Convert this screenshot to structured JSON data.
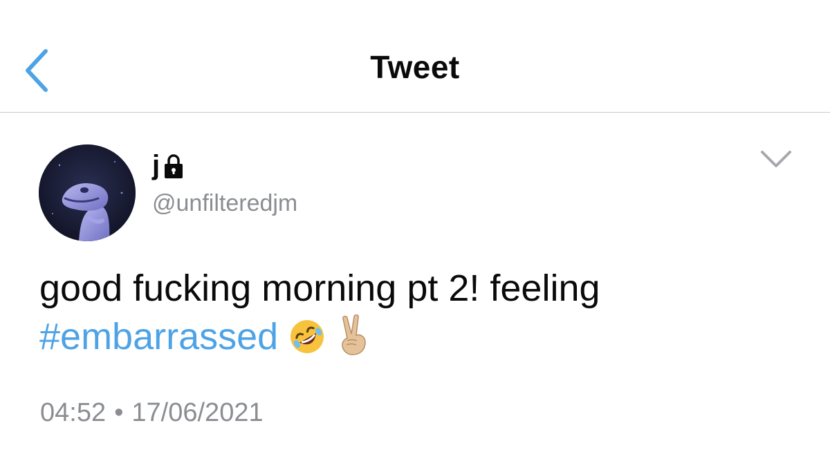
{
  "header": {
    "back_icon": "chevron-left-icon",
    "title": "Tweet"
  },
  "tweet": {
    "avatar": "user-avatar",
    "display_name": "j",
    "protected_icon": "lock-icon",
    "handle": "@unfilteredjm",
    "menu_icon": "chevron-down-icon",
    "text_line1": "good fucking morning pt 2! feeling",
    "hashtag": "#embarrassed",
    "emojis": [
      "rolling-on-floor-laughing-emoji",
      "victory-hand-emoji"
    ],
    "time": "04:52",
    "separator": "•",
    "date": "17/06/2021"
  },
  "colors": {
    "accent": "#4da3e6",
    "secondary_text": "#8a8d91",
    "divider": "#c9c9cc"
  }
}
